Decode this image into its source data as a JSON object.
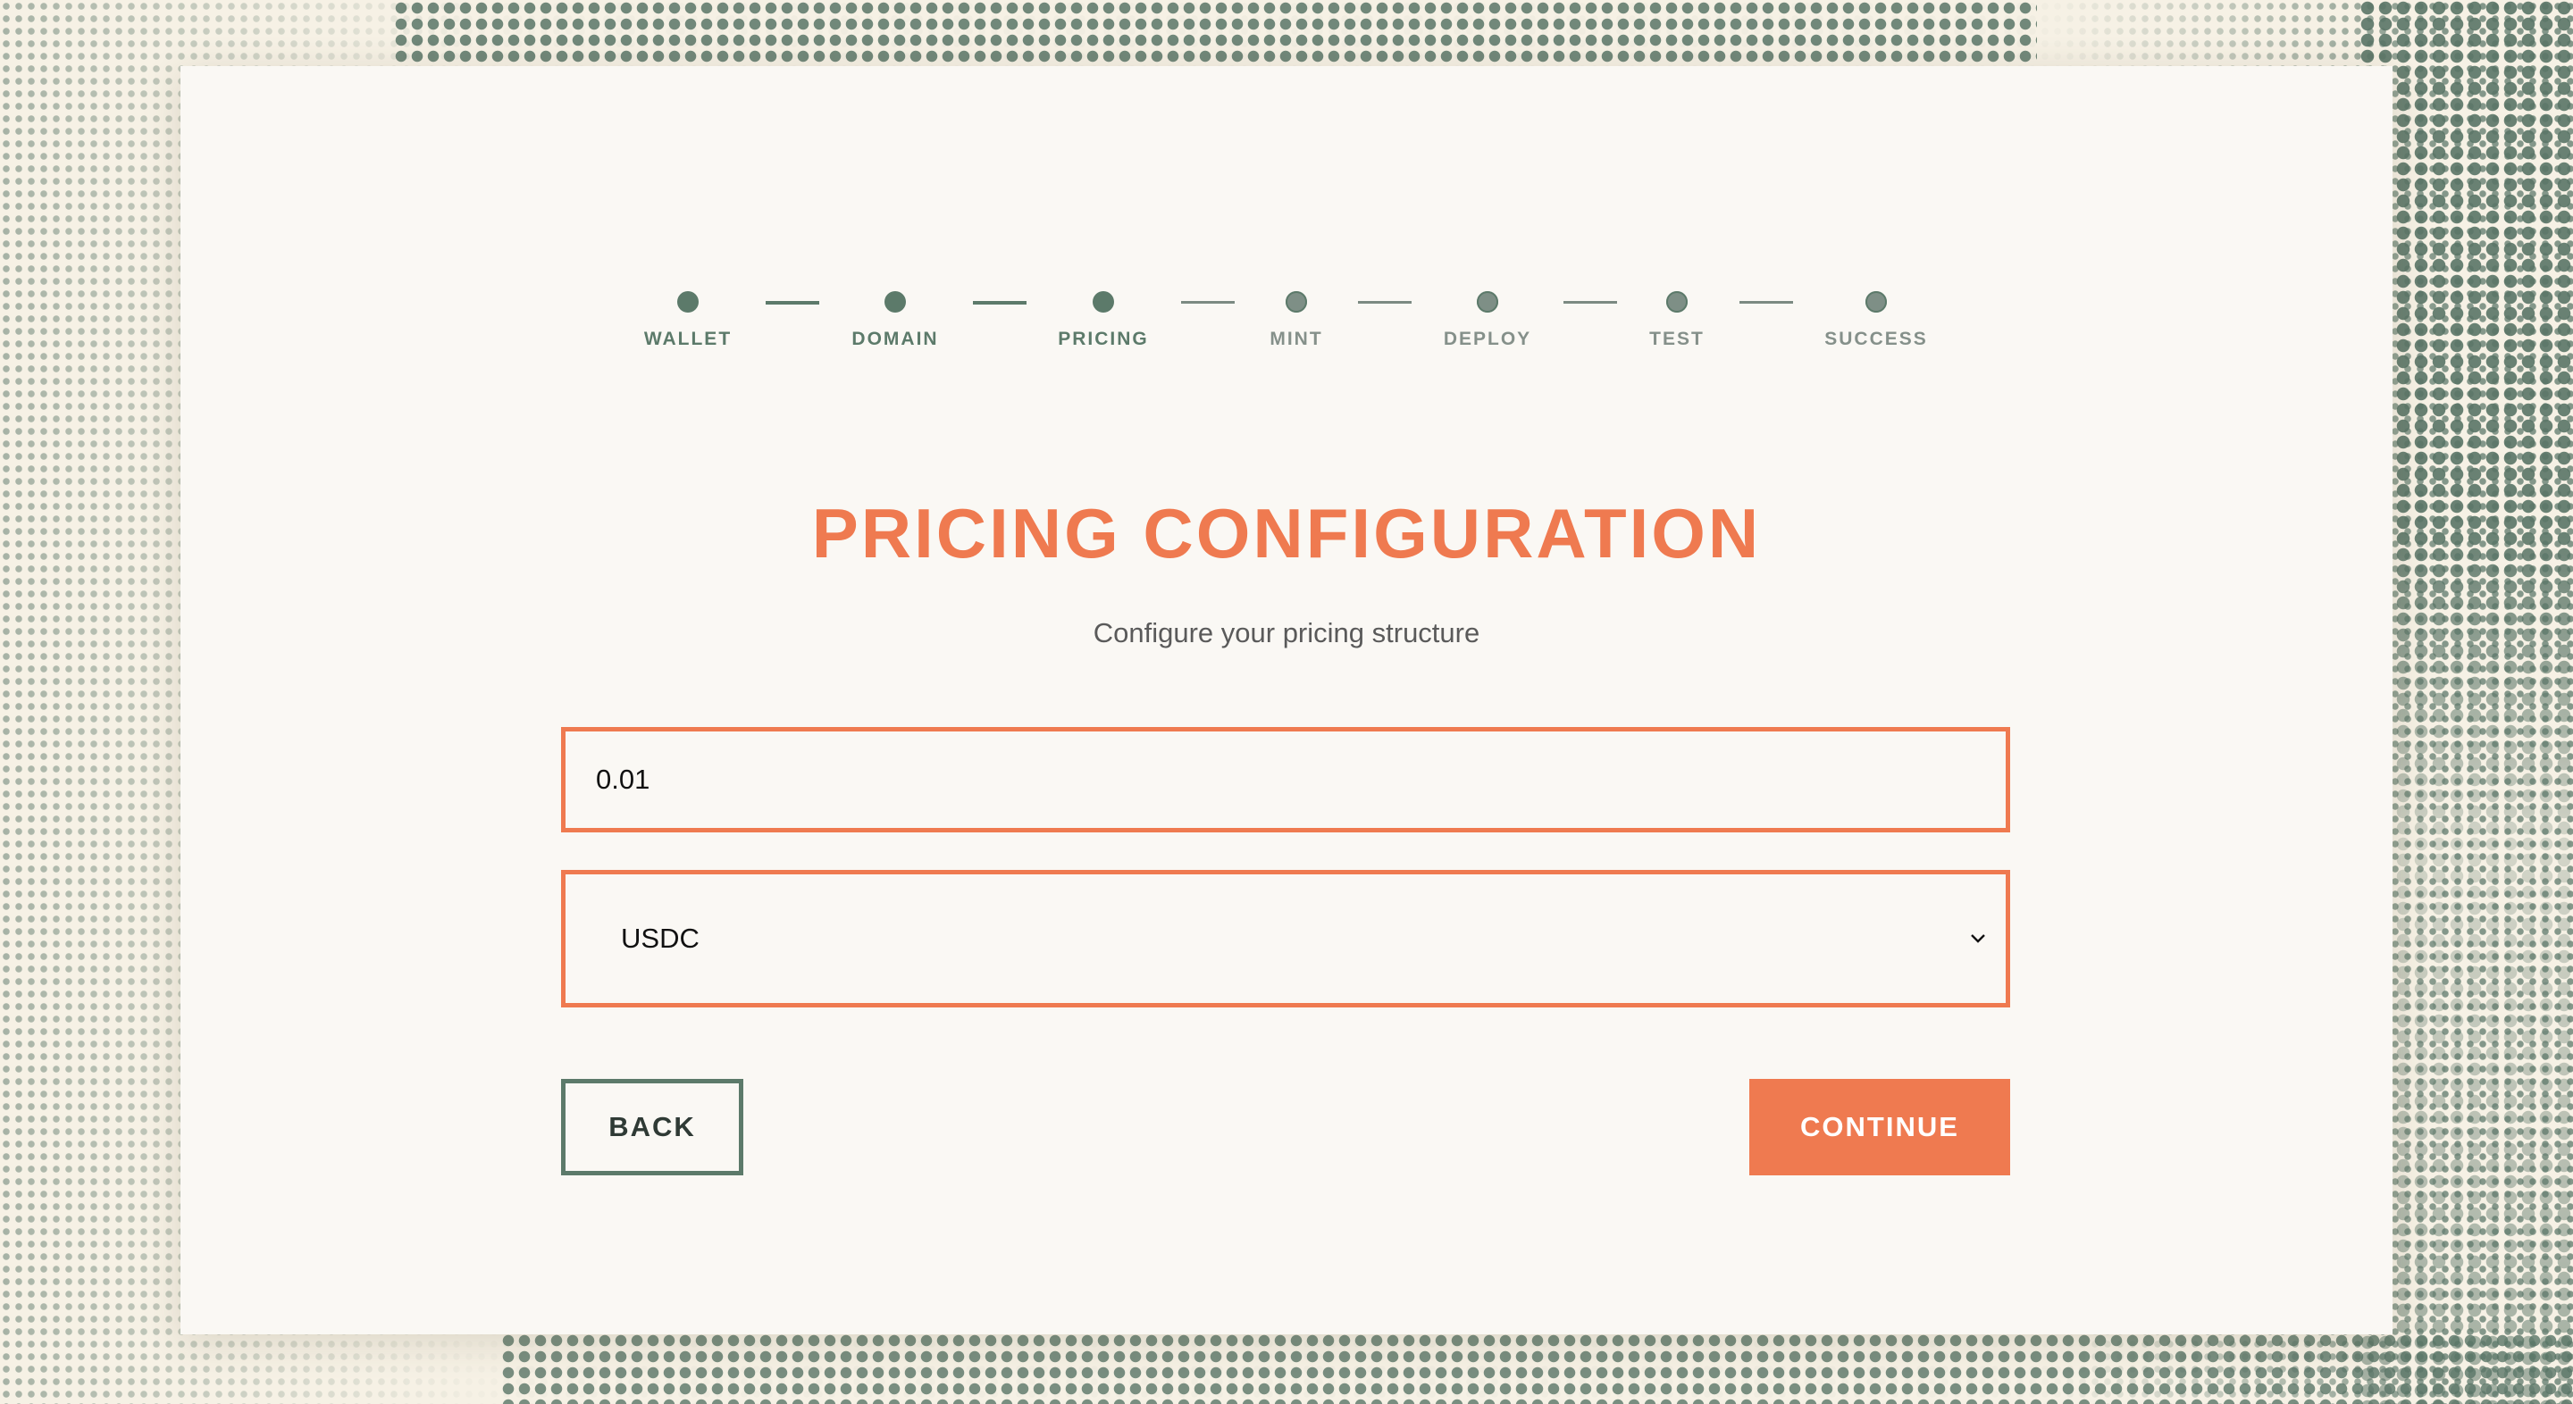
{
  "stepper": {
    "steps": [
      {
        "label": "WALLET",
        "state": "complete"
      },
      {
        "label": "DOMAIN",
        "state": "complete"
      },
      {
        "label": "PRICING",
        "state": "current"
      },
      {
        "label": "MINT",
        "state": "pending"
      },
      {
        "label": "DEPLOY",
        "state": "pending"
      },
      {
        "label": "TEST",
        "state": "pending"
      },
      {
        "label": "SUCCESS",
        "state": "pending"
      }
    ]
  },
  "header": {
    "title": "PRICING CONFIGURATION",
    "subtitle": "Configure your pricing structure"
  },
  "form": {
    "price_value": "0.01",
    "currency_selected": "USDC"
  },
  "actions": {
    "back_label": "BACK",
    "continue_label": "CONTINUE"
  },
  "colors": {
    "accent": "#ef7a50",
    "brand_green": "#5c7a6a",
    "background": "#f6f1e5",
    "card": "#faf8f4"
  },
  "icons": {
    "select_arrow": "chevron-down-icon",
    "step_marker": "step-dot-icon"
  }
}
